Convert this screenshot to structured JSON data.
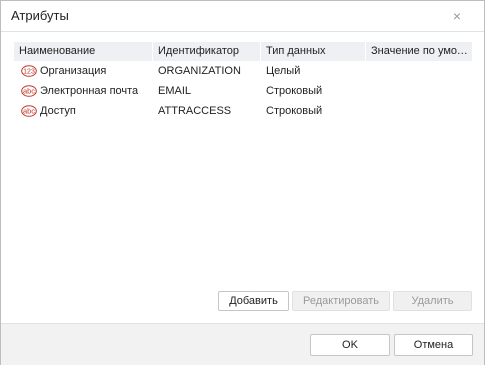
{
  "window": {
    "title": "Атрибуты",
    "close_glyph": "×"
  },
  "grid": {
    "columns": [
      "Наименование",
      "Идентификатор",
      "Тип данных",
      "Значение по умолчанию"
    ],
    "rows": [
      {
        "icon": "number-type-icon",
        "icon_text": "123",
        "name": "Организация",
        "id": "ORGANIZATION",
        "type": "Целый",
        "default": ""
      },
      {
        "icon": "string-type-icon",
        "icon_text": "abc",
        "name": "Электронная почта",
        "id": "EMAIL",
        "type": "Строковый",
        "default": ""
      },
      {
        "icon": "string-type-icon",
        "icon_text": "abc",
        "name": "Доступ",
        "id": "ATTRACCESS",
        "type": "Строковый",
        "default": ""
      }
    ]
  },
  "actions": {
    "add": "Добавить",
    "edit": "Редактировать",
    "delete": "Удалить"
  },
  "footer": {
    "ok": "OK",
    "cancel": "Отмена"
  },
  "colors": {
    "icon_accent": "#c0392b",
    "header_bg": "#eef0f3",
    "footer_bg": "#f2f2f2",
    "disabled_text": "#9a9a9a"
  }
}
